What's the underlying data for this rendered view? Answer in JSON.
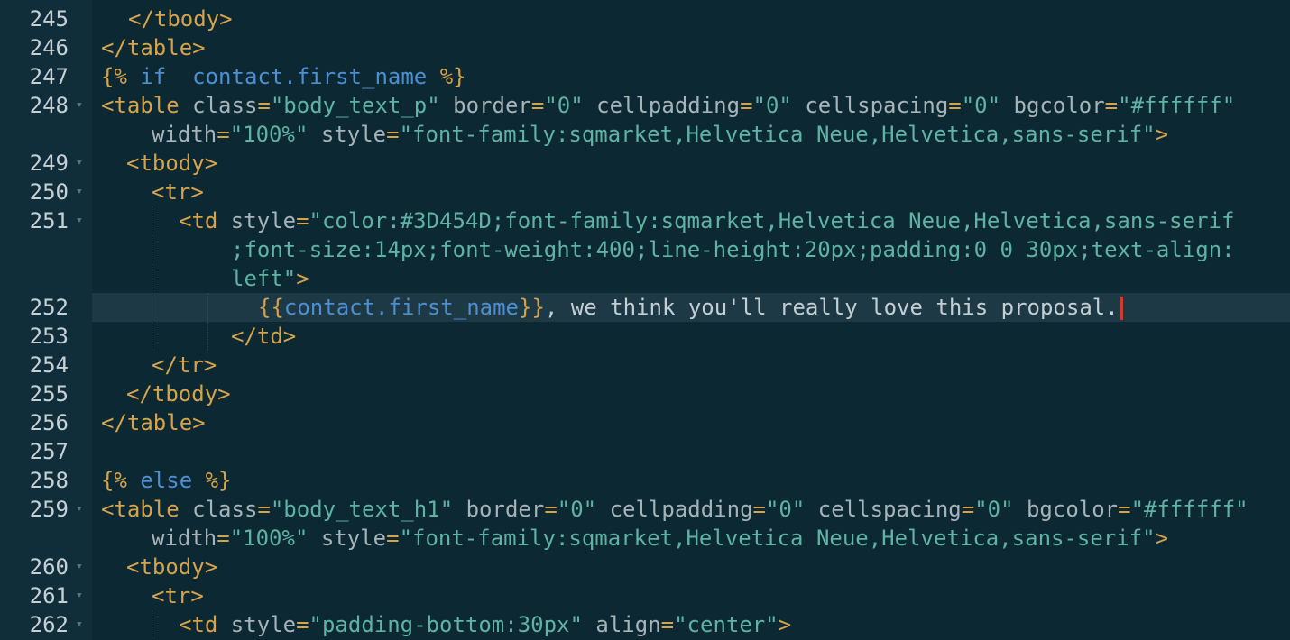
{
  "editor": {
    "lines": [
      {
        "no": "245",
        "tokens": [
          {
            "t": "tag",
            "v": "</tbody>"
          }
        ]
      },
      {
        "no": "246",
        "tokens": [
          {
            "t": "tag",
            "v": "</table>"
          }
        ]
      },
      {
        "no": "247",
        "tokens": [
          {
            "t": "tpl",
            "v": "{%"
          },
          {
            "t": "kw",
            "v": " if  "
          },
          {
            "t": "var",
            "v": "contact.first_name"
          },
          {
            "t": "tpl",
            "v": " %}"
          }
        ]
      },
      {
        "no": "248",
        "tokens": [
          {
            "t": "tag",
            "v": "<table"
          },
          {
            "t": "attr",
            "v": " class"
          },
          {
            "t": "eq",
            "v": "="
          },
          {
            "t": "val",
            "v": "\"body_text_p\""
          },
          {
            "t": "attr",
            "v": " border"
          },
          {
            "t": "eq",
            "v": "="
          },
          {
            "t": "val",
            "v": "\"0\""
          },
          {
            "t": "attr",
            "v": " cellpadding"
          },
          {
            "t": "eq",
            "v": "="
          },
          {
            "t": "val",
            "v": "\"0\""
          },
          {
            "t": "attr",
            "v": " cellspacing"
          },
          {
            "t": "eq",
            "v": "="
          },
          {
            "t": "val",
            "v": "\"0\""
          },
          {
            "t": "attr",
            "v": " bgcolor"
          },
          {
            "t": "eq",
            "v": "="
          },
          {
            "t": "val",
            "v": "\"#ffffff\""
          }
        ]
      },
      {
        "no": "",
        "tokens": [
          {
            "t": "attr",
            "v": "width"
          },
          {
            "t": "eq",
            "v": "="
          },
          {
            "t": "val",
            "v": "\"100%\""
          },
          {
            "t": "attr",
            "v": " style"
          },
          {
            "t": "eq",
            "v": "="
          },
          {
            "t": "val",
            "v": "\"font-family:sqmarket,Helvetica Neue,Helvetica,sans-serif\""
          },
          {
            "t": "tag",
            "v": ">"
          }
        ]
      },
      {
        "no": "249",
        "tokens": [
          {
            "t": "tag",
            "v": "<tbody>"
          }
        ]
      },
      {
        "no": "250",
        "tokens": [
          {
            "t": "tag",
            "v": "<tr>"
          }
        ]
      },
      {
        "no": "251",
        "tokens": [
          {
            "t": "tag",
            "v": "<td"
          },
          {
            "t": "attr",
            "v": " style"
          },
          {
            "t": "eq",
            "v": "="
          },
          {
            "t": "val",
            "v": "\"color:#3D454D;font-family:sqmarket,Helvetica Neue,Helvetica,sans-serif"
          }
        ]
      },
      {
        "no": "",
        "tokens": [
          {
            "t": "val",
            "v": ";font-size:14px;font-weight:400;line-height:20px;padding:0 0 30px;text-align:"
          }
        ]
      },
      {
        "no": "",
        "tokens": [
          {
            "t": "val",
            "v": "left\""
          },
          {
            "t": "tag",
            "v": ">"
          }
        ]
      },
      {
        "no": "252",
        "tokens": [
          {
            "t": "tpl",
            "v": "{{"
          },
          {
            "t": "var",
            "v": "contact.first_name"
          },
          {
            "t": "tpl",
            "v": "}}"
          },
          {
            "t": "plain",
            "v": ", we think you'll really love this proposal."
          }
        ]
      },
      {
        "no": "253",
        "tokens": [
          {
            "t": "tag",
            "v": "</td>"
          }
        ]
      },
      {
        "no": "254",
        "tokens": [
          {
            "t": "tag",
            "v": "</tr>"
          }
        ]
      },
      {
        "no": "255",
        "tokens": [
          {
            "t": "tag",
            "v": "</tbody>"
          }
        ]
      },
      {
        "no": "256",
        "tokens": [
          {
            "t": "tag",
            "v": "</table>"
          }
        ]
      },
      {
        "no": "257",
        "tokens": []
      },
      {
        "no": "258",
        "tokens": [
          {
            "t": "tpl",
            "v": "{%"
          },
          {
            "t": "kw",
            "v": " else "
          },
          {
            "t": "tpl",
            "v": "%}"
          }
        ]
      },
      {
        "no": "259",
        "tokens": [
          {
            "t": "tag",
            "v": "<table"
          },
          {
            "t": "attr",
            "v": " class"
          },
          {
            "t": "eq",
            "v": "="
          },
          {
            "t": "val",
            "v": "\"body_text_h1\""
          },
          {
            "t": "attr",
            "v": " border"
          },
          {
            "t": "eq",
            "v": "="
          },
          {
            "t": "val",
            "v": "\"0\""
          },
          {
            "t": "attr",
            "v": " cellpadding"
          },
          {
            "t": "eq",
            "v": "="
          },
          {
            "t": "val",
            "v": "\"0\""
          },
          {
            "t": "attr",
            "v": " cellspacing"
          },
          {
            "t": "eq",
            "v": "="
          },
          {
            "t": "val",
            "v": "\"0\""
          },
          {
            "t": "attr",
            "v": " bgcolor"
          },
          {
            "t": "eq",
            "v": "="
          },
          {
            "t": "val",
            "v": "\"#ffffff\""
          }
        ]
      },
      {
        "no": "",
        "tokens": [
          {
            "t": "attr",
            "v": "width"
          },
          {
            "t": "eq",
            "v": "="
          },
          {
            "t": "val",
            "v": "\"100%\""
          },
          {
            "t": "attr",
            "v": " style"
          },
          {
            "t": "eq",
            "v": "="
          },
          {
            "t": "val",
            "v": "\"font-family:sqmarket,Helvetica Neue,Helvetica,sans-serif\""
          },
          {
            "t": "tag",
            "v": ">"
          }
        ]
      },
      {
        "no": "260",
        "tokens": [
          {
            "t": "tag",
            "v": "<tbody>"
          }
        ]
      },
      {
        "no": "261",
        "tokens": [
          {
            "t": "tag",
            "v": "<tr>"
          }
        ]
      },
      {
        "no": "262",
        "tokens": [
          {
            "t": "tag",
            "v": "<td"
          },
          {
            "t": "attr",
            "v": " style"
          },
          {
            "t": "eq",
            "v": "="
          },
          {
            "t": "val",
            "v": "\"padding-bottom:30px\""
          },
          {
            "t": "attr",
            "v": " align"
          },
          {
            "t": "eq",
            "v": "="
          },
          {
            "t": "val",
            "v": "\"center\""
          },
          {
            "t": "tag",
            "v": ">"
          }
        ]
      }
    ],
    "fold_icon": "fold-arrow-icon",
    "colors": {
      "background": "#0c2832",
      "active_line": "#1d3945",
      "cursor": "#d13b2e"
    }
  }
}
